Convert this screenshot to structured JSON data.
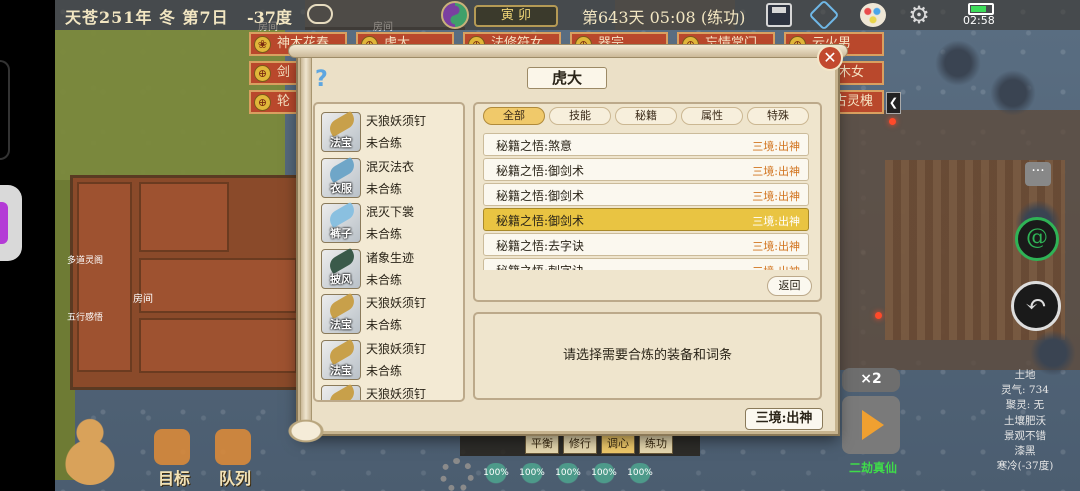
{
  "status_bar": {
    "date": "天苍251年 冬 第7日",
    "temperature": "-37度",
    "shichen": "寅 卯",
    "day_time": "第643天 05:08 (练功)",
    "clock": "02:58",
    "battery_level": 0.75
  },
  "sect_tags": [
    {
      "label": "神木花春"
    },
    {
      "label": "虎大"
    },
    {
      "label": "法修符女"
    },
    {
      "label": "器宗"
    },
    {
      "label": "忘情掌门"
    },
    {
      "label": "云火男"
    },
    {
      "label": "剑"
    },
    {
      "label": "木女"
    },
    {
      "label": "轮"
    },
    {
      "label": "古灵槐"
    }
  ],
  "map_labels": {
    "room1": "房间",
    "room2": "房间",
    "room3": "房间",
    "shop": "多道灵阁",
    "eye": "五行感悟"
  },
  "modal": {
    "title": "虎大",
    "equipment": [
      {
        "name": "天狼妖须钉",
        "type": "法宝",
        "status": "未合练",
        "color": "#c8a04a"
      },
      {
        "name": "泯灭法衣",
        "type": "衣服",
        "status": "未合练",
        "color": "#6fa6c8"
      },
      {
        "name": "泯灭下裳",
        "type": "裤子",
        "status": "未合练",
        "color": "#8ac0e0"
      },
      {
        "name": "诸象生迹",
        "type": "披风",
        "status": "未合练",
        "color": "#3a5a4a"
      },
      {
        "name": "天狼妖须钉",
        "type": "法宝",
        "status": "未合练",
        "color": "#c8a04a"
      },
      {
        "name": "天狼妖须钉",
        "type": "法宝",
        "status": "未合练",
        "color": "#c8a04a"
      },
      {
        "name": "天狼妖须钉",
        "type": "法宝",
        "status": "",
        "color": "#c8a04a"
      }
    ],
    "tabs": [
      "全部",
      "技能",
      "秘籍",
      "属性",
      "特殊"
    ],
    "active_tab": "全部",
    "entries": [
      {
        "name": "秘籍之悟:煞意",
        "stage": "三境:出神",
        "selected": false
      },
      {
        "name": "秘籍之悟:御剑术",
        "stage": "三境:出神",
        "selected": false
      },
      {
        "name": "秘籍之悟:御剑术",
        "stage": "三境:出神",
        "selected": false
      },
      {
        "name": "秘籍之悟:御剑术",
        "stage": "三境:出神",
        "selected": true
      },
      {
        "name": "秘籍之悟:去字诀",
        "stage": "三境:出神",
        "selected": false
      },
      {
        "name": "秘籍之悟:刺字诀",
        "stage": "三境:出神",
        "selected": false
      }
    ],
    "return_label": "返回",
    "prompt": "请选择需要合炼的装备和词条",
    "realm_button": "三境:出神"
  },
  "bottom_left": {
    "target_label": "目标",
    "team_label": "队列"
  },
  "bottom_bar": {
    "buttons": [
      "平衡",
      "修行",
      "调心",
      "练功"
    ],
    "active": "调心",
    "percents": [
      "100%",
      "100%",
      "100%",
      "100%",
      "100%"
    ]
  },
  "right_panel": {
    "speed": "×2",
    "stage_name": "二劫真仙",
    "tile_info": [
      "土地",
      "灵气: 734",
      "聚灵: 无",
      "土壤肥沃",
      "景观不错",
      "漆黑",
      "寒冷(-37度)"
    ]
  },
  "colors": {
    "tag_red": "#b9482c",
    "selected_row": "#e9c442",
    "stage_orange": "#d2741f",
    "accent_green": "#3fdc4a"
  }
}
